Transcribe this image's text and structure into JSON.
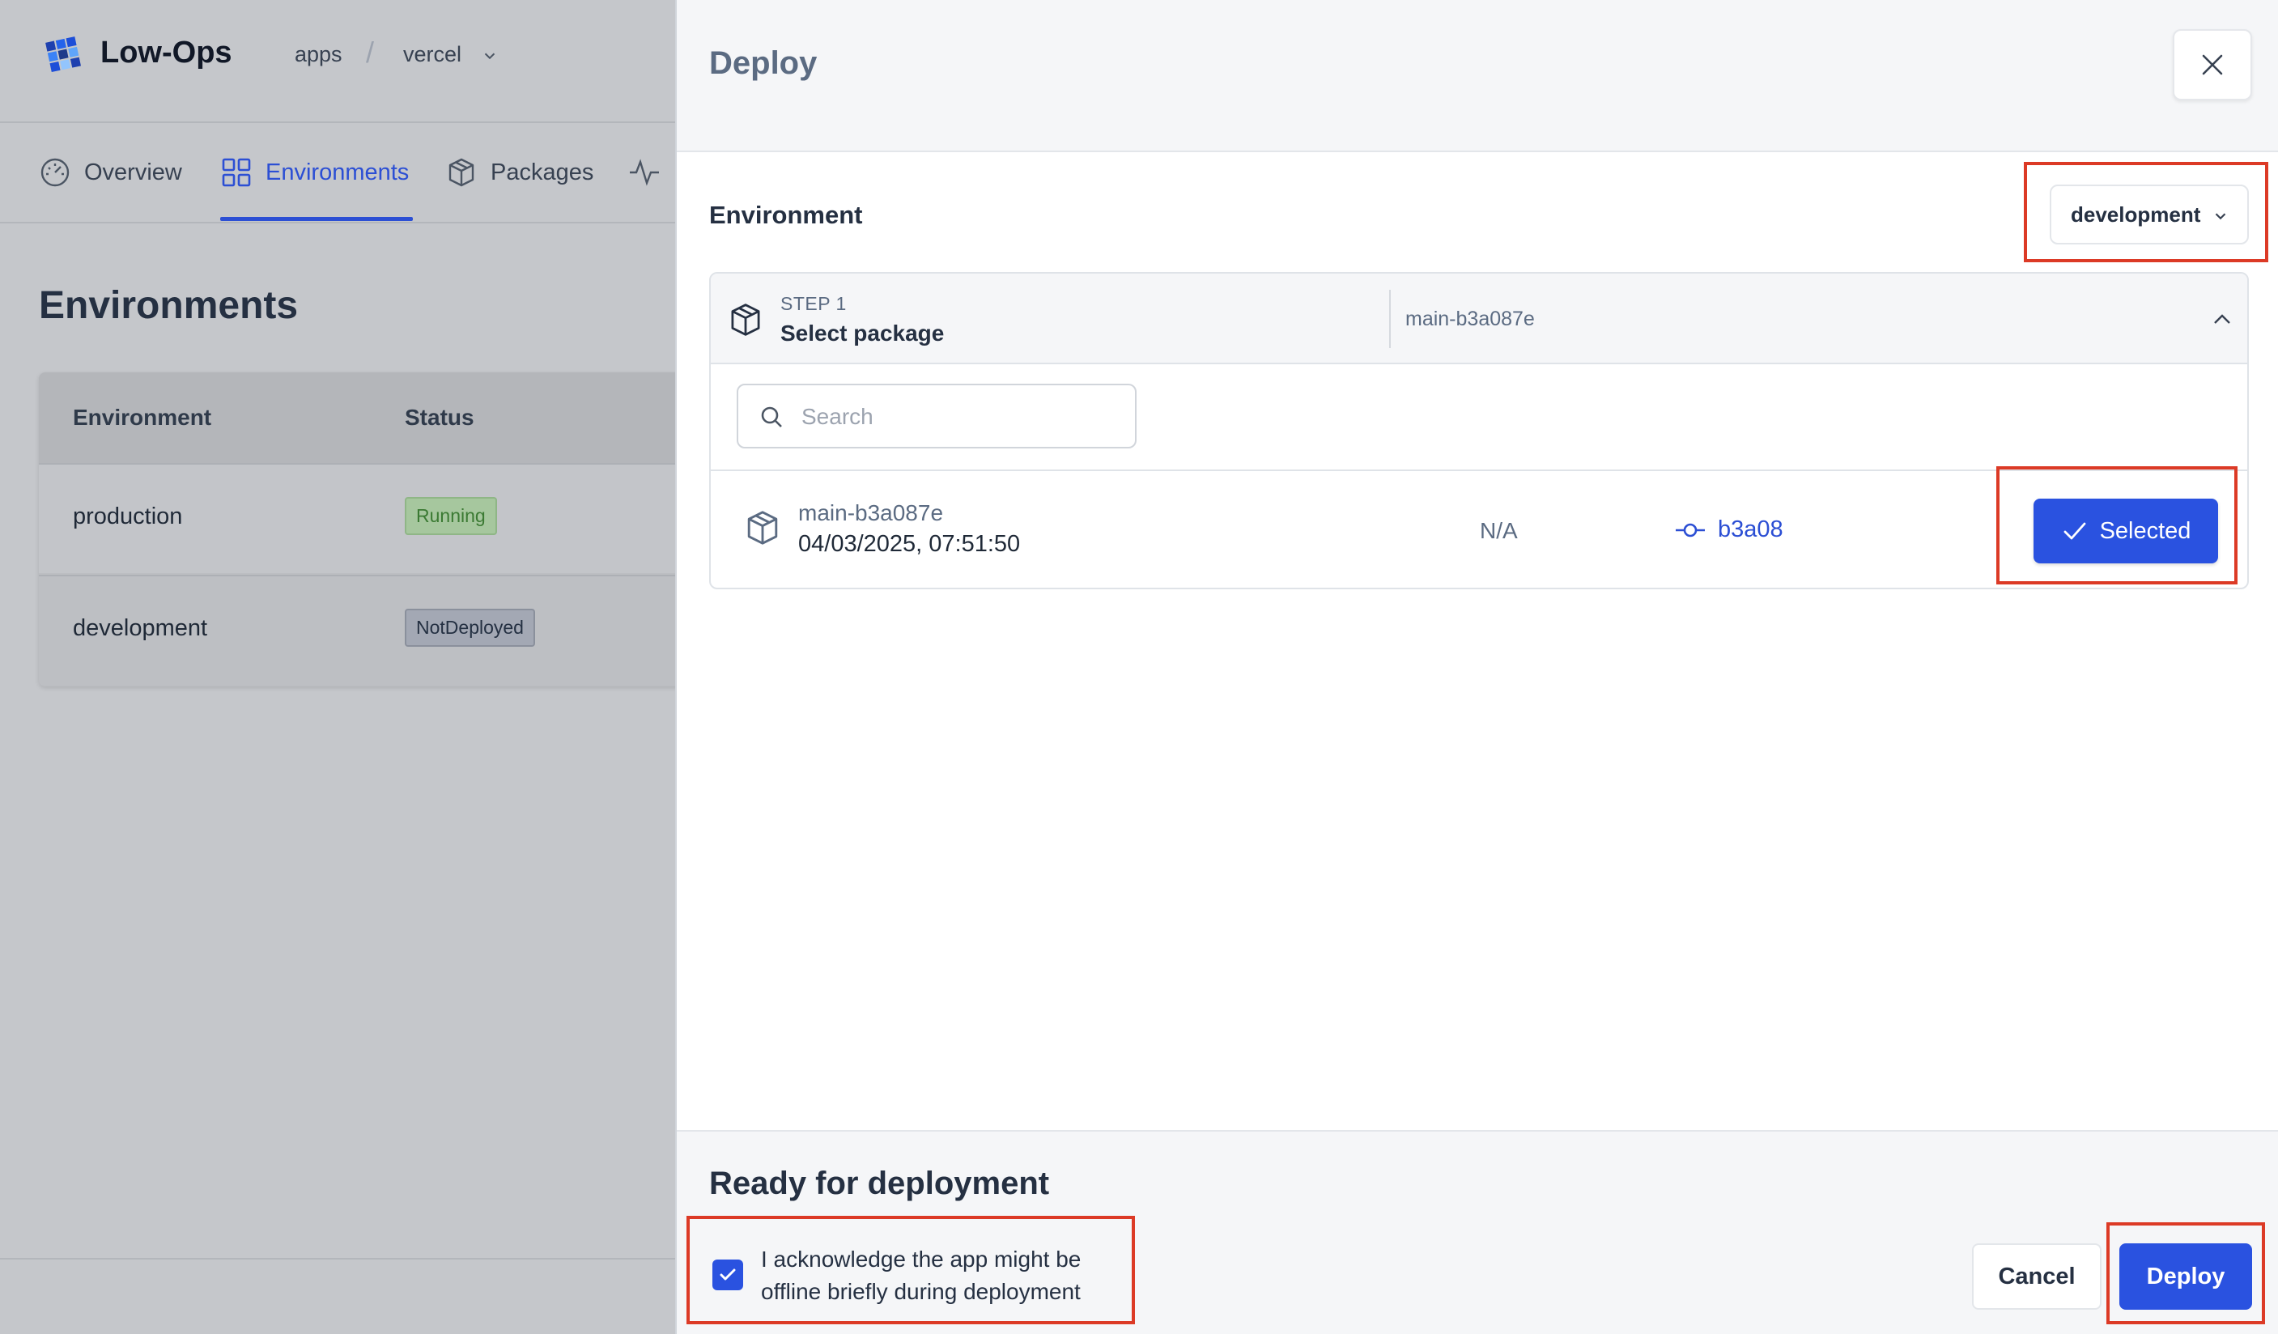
{
  "app": {
    "brand": "Low-Ops",
    "breadcrumb": {
      "apps": "apps",
      "separator": "/",
      "project": "vercel"
    },
    "tabs": [
      {
        "label": "Overview",
        "icon": "gauge-icon"
      },
      {
        "label": "Environments",
        "icon": "grid-icon",
        "active": true
      },
      {
        "label": "Packages",
        "icon": "package-icon"
      },
      {
        "label": "",
        "icon": "activity-icon"
      }
    ],
    "page_title": "Environments",
    "table": {
      "headers": [
        "Environment",
        "Status"
      ],
      "rows": [
        {
          "environment": "production",
          "status": "Running"
        },
        {
          "environment": "development",
          "status": "NotDeployed"
        }
      ]
    }
  },
  "drawer": {
    "title": "Deploy",
    "environment_label": "Environment",
    "environment_selected": "development",
    "step": {
      "number": "STEP 1",
      "name": "Select package",
      "value": "main-b3a087e"
    },
    "search": {
      "placeholder": "Search",
      "value": ""
    },
    "package": {
      "name": "main-b3a087e",
      "date": "04/03/2025, 07:51:50",
      "na": "N/A",
      "commit": "b3a08",
      "button": "Selected"
    },
    "footer": {
      "ready_title": "Ready for deployment",
      "acknowledge": "I acknowledge the app might be offline briefly during deployment",
      "acknowledge_checked": true,
      "cancel": "Cancel",
      "deploy": "Deploy"
    }
  },
  "colors": {
    "accent": "#2a52e0",
    "highlight": "#dc3a26",
    "running": "#3b7a33"
  }
}
